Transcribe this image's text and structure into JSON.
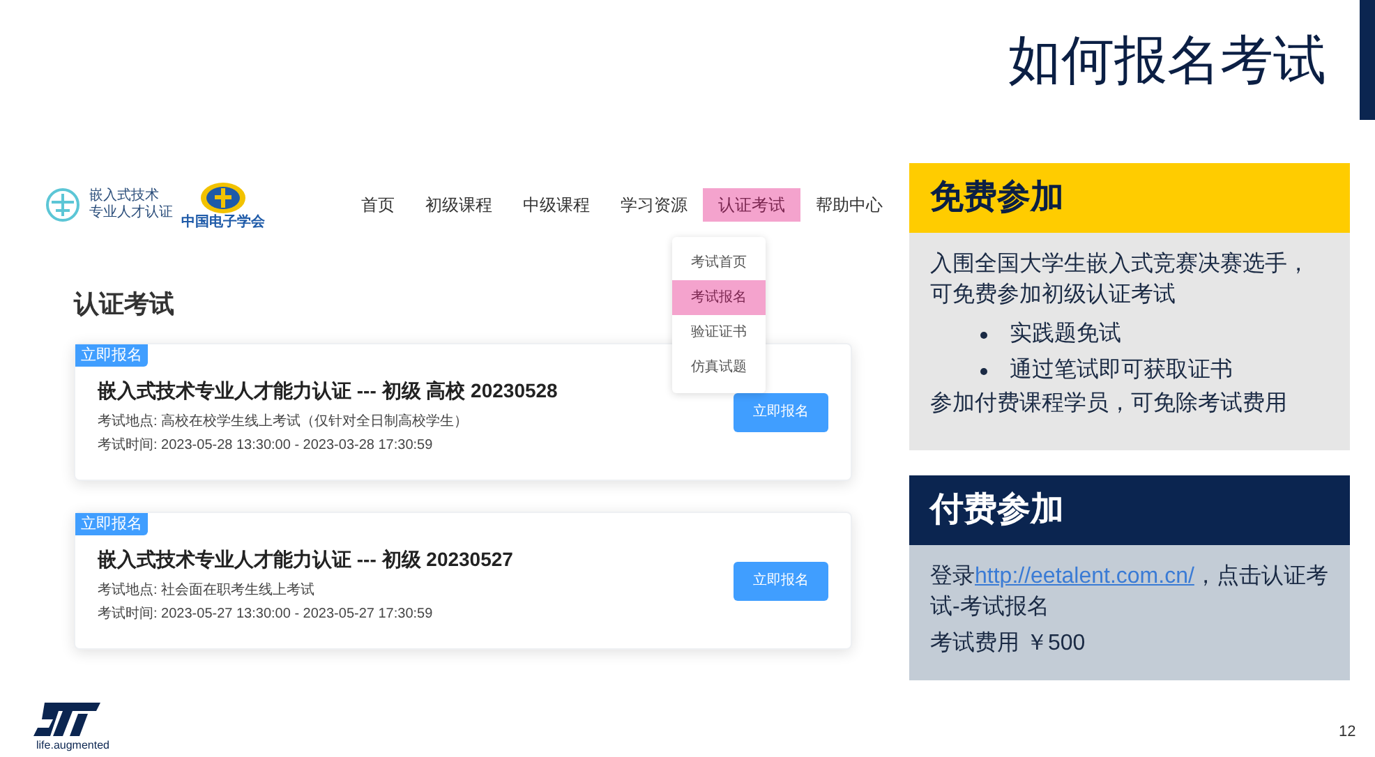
{
  "slide": {
    "title": "如何报名考试",
    "page_number": "12",
    "logo_tagline": "life.augmented"
  },
  "website": {
    "logo_lines": [
      "嵌入式技术",
      "专业人才认证"
    ],
    "society_logo_text": "中国电子学会",
    "nav": [
      {
        "label": "首页",
        "selected": false
      },
      {
        "label": "初级课程",
        "selected": false
      },
      {
        "label": "中级课程",
        "selected": false
      },
      {
        "label": "学习资源",
        "selected": false
      },
      {
        "label": "认证考试",
        "selected": true
      },
      {
        "label": "帮助中心",
        "selected": false
      }
    ],
    "dropdown": [
      {
        "label": "考试首页",
        "selected": false
      },
      {
        "label": "考试报名",
        "selected": true
      },
      {
        "label": "验证证书",
        "selected": false
      },
      {
        "label": "仿真试题",
        "selected": false
      }
    ],
    "heading": "认证考试",
    "exams": [
      {
        "badge": "立即报名",
        "title": "嵌入式技术专业人才能力认证 --- 初级 高校 20230528",
        "location": "考试地点: 高校在校学生线上考试（仅针对全日制高校学生）",
        "time": "考试时间: 2023-05-28 13:30:00 - 2023-03-28 17:30:59",
        "button": "立即报名"
      },
      {
        "badge": "立即报名",
        "title": "嵌入式技术专业人才能力认证 --- 初级 20230527",
        "location": "考试地点: 社会面在职考生线上考试",
        "time": "考试时间: 2023-05-27 13:30:00 - 2023-05-27 17:30:59",
        "button": "立即报名"
      }
    ]
  },
  "panels": [
    {
      "kind": "free",
      "title": "免费参加",
      "body": [
        {
          "kind": "text",
          "text": "入围全国大学生嵌入式竞赛决赛选手，可免费参加初级认证考试"
        },
        {
          "kind": "bullet",
          "text": "实践题免试"
        },
        {
          "kind": "bullet",
          "text": "通过笔试即可获取证书"
        },
        {
          "kind": "text",
          "text": "参加付费课程学员，可免除考试费用"
        }
      ]
    },
    {
      "kind": "paid",
      "title": "付费参加",
      "body": [
        {
          "kind": "link_text",
          "before": "登录",
          "link": "http://eetalent.com.cn/",
          "after": "，点击认证考试-考试报名"
        },
        {
          "kind": "text",
          "text": "考试费用 ￥500"
        }
      ]
    }
  ]
}
